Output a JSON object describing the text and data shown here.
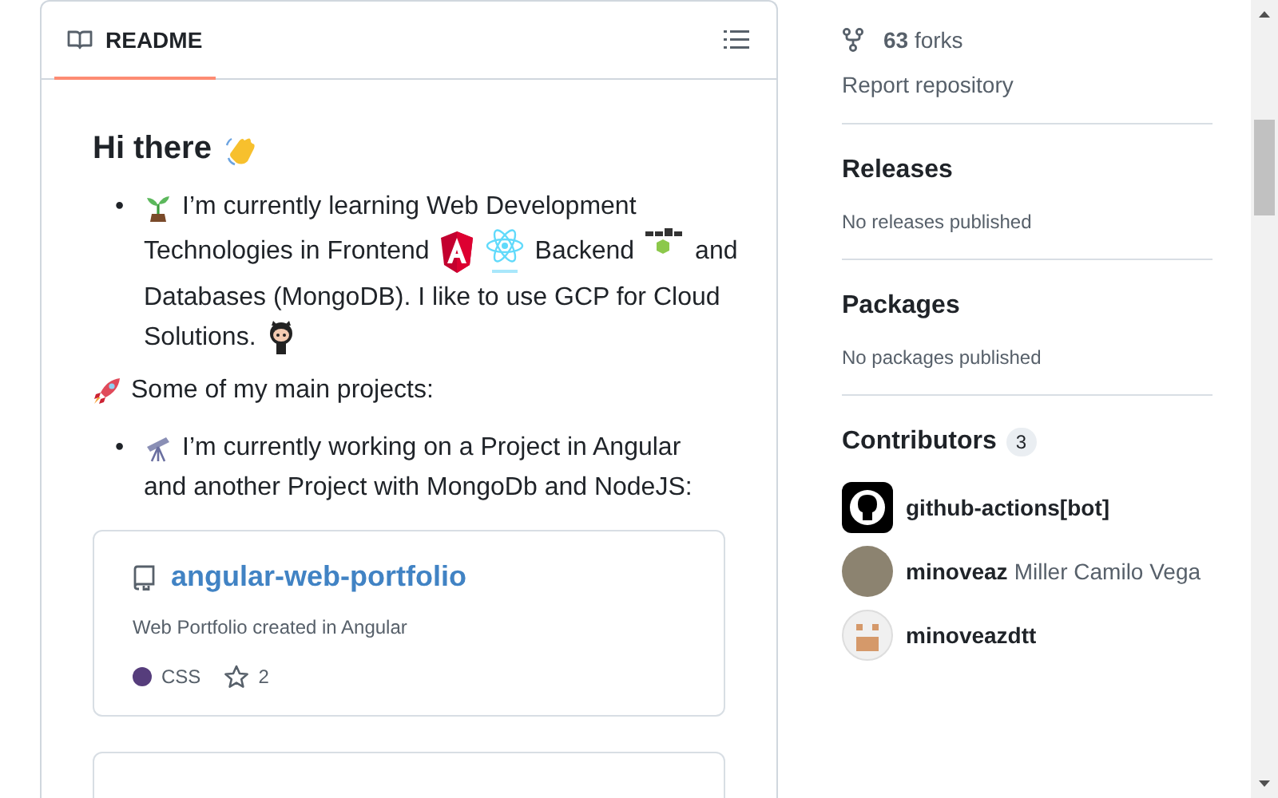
{
  "readme": {
    "tab": {
      "label": "README",
      "selected": true
    },
    "heading": "Hi there",
    "bullet_1": "•",
    "intro_segments": [
      "I’m currently learning Web Development",
      "Technologies in Frontend",
      "Backend",
      "and",
      "Databases (MongoDB). I like to use GCP for Cloud",
      "Solutions."
    ],
    "projects_intro": "Some of my main projects:",
    "bullet_2": "•",
    "projects_item": [
      "I’m currently working on a Project in Angular",
      "and another Project with MongoDb and NodeJS:"
    ],
    "cards": [
      {
        "name": "angular-web-portfolio",
        "description": "Web Portfolio created in Angular",
        "language": "CSS",
        "color": "#563d7c",
        "stars": "2"
      }
    ]
  },
  "sidebar": {
    "forks": "**63** forks",
    "report": "Report repository",
    "sections": [
      {
        "title": "Releases",
        "empty": "No releases published"
      },
      {
        "title": "Packages",
        "empty": "No packages published"
      }
    ],
    "contributors": {
      "title": "Contributors",
      "count": "3",
      "items": [
        {
          "login": "github-actions[bot]",
          "kind": "bot"
        },
        {
          "login": "minoveaz",
          "name": "Miller Camilo Vega",
          "kind": "photo"
        },
        {
          "login": "minoveazdtt",
          "kind": "identicon"
        }
      ]
    }
  }
}
